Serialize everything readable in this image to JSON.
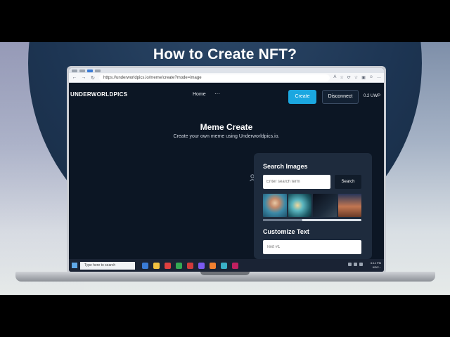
{
  "video": {
    "title": "How to Create NFT?"
  },
  "browser": {
    "url": "https://underworldpics.io/meme/create?mode=image",
    "nav_icons": [
      "←",
      "→",
      "↻"
    ],
    "ext_icons": [
      "A",
      "☆",
      "⟳",
      "☆",
      "▣",
      "☺",
      "…"
    ]
  },
  "site": {
    "logo": "UNDERWORLDPICS",
    "nav": {
      "home": "Home",
      "more": "···"
    },
    "buttons": {
      "create": "Create",
      "disconnect": "Disconnect"
    },
    "balance": "0.2 UWP"
  },
  "page": {
    "title": "Meme Create",
    "subtitle": "Create your own meme using Underworldpics.io."
  },
  "search_panel": {
    "title": "Search Images",
    "placeholder": "Enter search term",
    "button": "Search",
    "images": [
      "woman in blue scarf",
      "fantasy glowing scene",
      "dark night scene",
      "sunset landscape"
    ],
    "scroll_position": 0.4
  },
  "customize_panel": {
    "title": "Customize Text",
    "placeholder": "Text #1"
  },
  "taskbar": {
    "search_placeholder": "Type here to search",
    "apps": [
      "#3a7bd5",
      "#f0c040",
      "#e04040",
      "#34a853",
      "#d03a3a",
      "#7a5af0",
      "#f08030",
      "#3ab0c8",
      "#c02060"
    ],
    "time": "6:14 PM",
    "date": "6/30/..."
  },
  "colors": {
    "accent": "#1ba7e0",
    "site_bg": "#0c1624",
    "panel_bg": "#1e2b3d"
  },
  "icons": {
    "upload_placeholder": "person-upload-icon"
  }
}
